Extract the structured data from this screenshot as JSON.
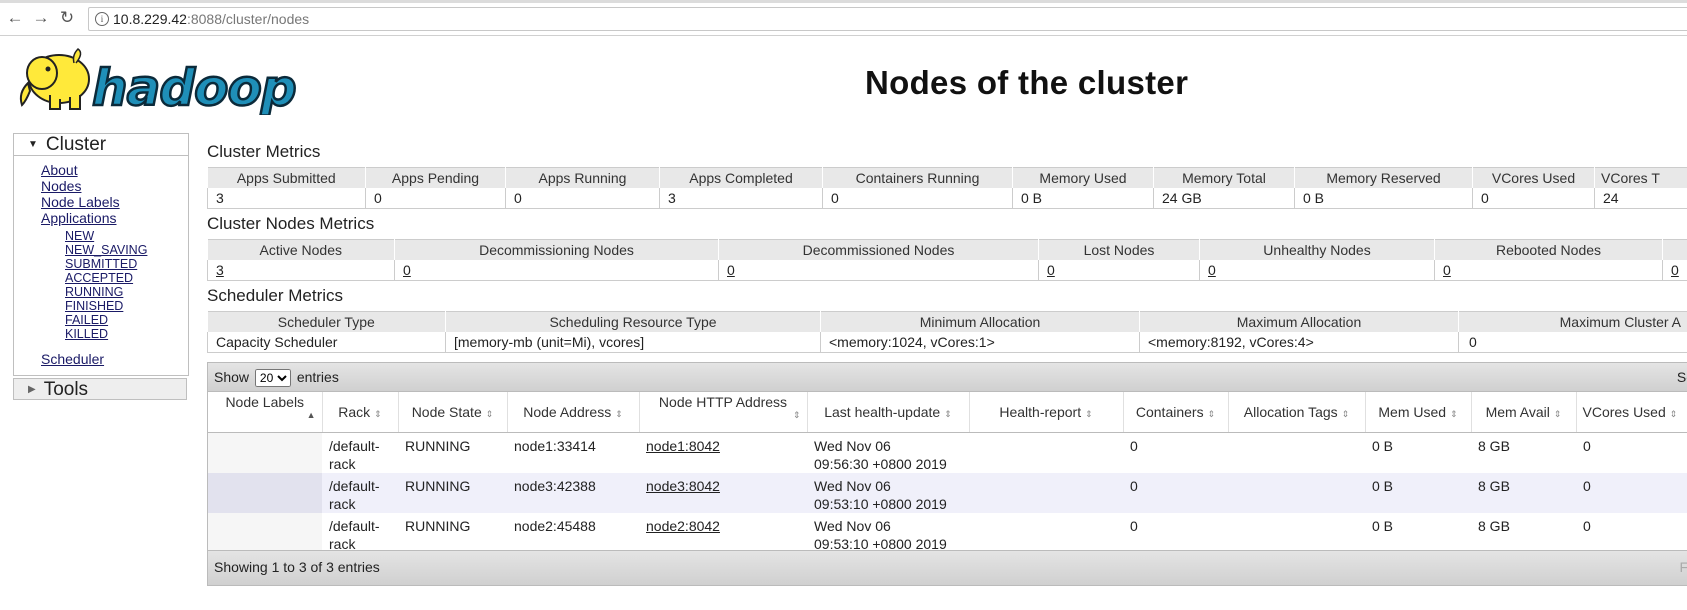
{
  "browser": {
    "url_host": "10.8.229.42",
    "url_rest": ":8088/cluster/nodes"
  },
  "header": {
    "logo_text": "hadoop",
    "title": "Nodes of the cluster"
  },
  "nav": {
    "cluster_label": "Cluster",
    "links": [
      "About",
      "Nodes",
      "Node Labels",
      "Applications"
    ],
    "app_states": [
      "NEW",
      "NEW_SAVING",
      "SUBMITTED",
      "ACCEPTED",
      "RUNNING",
      "FINISHED",
      "FAILED",
      "KILLED"
    ],
    "scheduler": "Scheduler",
    "tools_label": "Tools"
  },
  "cluster_metrics": {
    "title": "Cluster Metrics",
    "headers": [
      "Apps Submitted",
      "Apps Pending",
      "Apps Running",
      "Apps Completed",
      "Containers Running",
      "Memory Used",
      "Memory Total",
      "Memory Reserved",
      "VCores Used",
      "VCores T"
    ],
    "values": [
      "3",
      "0",
      "0",
      "3",
      "0",
      "0 B",
      "24 GB",
      "0 B",
      "0",
      "24"
    ]
  },
  "nodes_metrics": {
    "title": "Cluster Nodes Metrics",
    "headers": [
      "Active Nodes",
      "Decommissioning Nodes",
      "Decommissioned Nodes",
      "Lost Nodes",
      "Unhealthy Nodes",
      "Rebooted Nodes",
      ""
    ],
    "values": [
      "3",
      "0",
      "0",
      "0",
      "0",
      "0",
      "0"
    ]
  },
  "scheduler_metrics": {
    "title": "Scheduler Metrics",
    "headers": [
      "Scheduler Type",
      "Scheduling Resource Type",
      "Minimum Allocation",
      "Maximum Allocation",
      "Maximum Cluster A"
    ],
    "values": [
      "Capacity Scheduler",
      "[memory-mb (unit=Mi), vcores]",
      "<memory:1024, vCores:1>",
      "<memory:8192, vCores:4>",
      "0"
    ]
  },
  "nodes_table": {
    "show_label": "Show",
    "page_size": "20",
    "entries_label": "entries",
    "search_label": "Se",
    "headers": [
      "Node Labels",
      "Rack",
      "Node State",
      "Node Address",
      "Node HTTP Address",
      "Last health-update",
      "Health-report",
      "Containers",
      "Allocation Tags",
      "Mem Used",
      "Mem Avail",
      "VCores Used"
    ],
    "rows": [
      {
        "labels": "",
        "rack": "/default-rack",
        "state": "RUNNING",
        "address": "node1:33414",
        "http": "node1:8042",
        "health_date": "Wed Nov 06",
        "health_time": "09:56:30 +0800 2019",
        "report": "",
        "containers": "0",
        "tags": "",
        "mem_used": "0 B",
        "mem_avail": "8 GB",
        "vcores_used": "0"
      },
      {
        "labels": "",
        "rack": "/default-rack",
        "state": "RUNNING",
        "address": "node3:42388",
        "http": "node3:8042",
        "health_date": "Wed Nov 06",
        "health_time": "09:53:10 +0800 2019",
        "report": "",
        "containers": "0",
        "tags": "",
        "mem_used": "0 B",
        "mem_avail": "8 GB",
        "vcores_used": "0"
      },
      {
        "labels": "",
        "rack": "/default-rack",
        "state": "RUNNING",
        "address": "node2:45488",
        "http": "node2:8042",
        "health_date": "Wed Nov 06",
        "health_time": "09:53:10 +0800 2019",
        "report": "",
        "containers": "0",
        "tags": "",
        "mem_used": "0 B",
        "mem_avail": "8 GB",
        "vcores_used": "0"
      }
    ],
    "footer": "Showing 1 to 3 of 3 entries",
    "footer_right": "F"
  }
}
